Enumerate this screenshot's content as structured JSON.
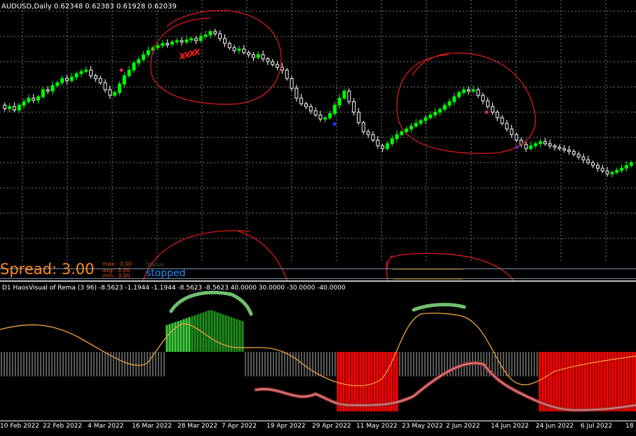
{
  "chart": {
    "symbol_title": "AUDUSD,Daily  0.62348 0.62383 0.61928 0.62039",
    "bull_color": "#00ff00",
    "bear_color": "#ffffff",
    "grid_color": "#7a7a7a",
    "annotation_color": "#e31d1d"
  },
  "spread": {
    "label": "Spread: 3.00",
    "stats": [
      {
        "label": "max:",
        "value": "3.00"
      },
      {
        "label": "avg:",
        "value": "3.00"
      },
      {
        "label": "min:",
        "value": "3.00"
      }
    ],
    "status_caption": "Status",
    "status_value": "stopped"
  },
  "indicator": {
    "title": "D1 HaosVisual of Rema (3 96) -8.5623 -1.1944 -1.1944 -8.5623 -8.5623 40.0000 30.0000 -30.0000 -40.0000",
    "up_color": "#1e8c1e",
    "down_color": "#ff0000",
    "fast_line_color": "#f2a33a"
  },
  "time_axis": {
    "labels": [
      "10 Feb 2022",
      "22 Feb 2022",
      "4 Mar 2022",
      "16 Mar 2022",
      "28 Mar 2022",
      "7 Apr 2022",
      "19 Apr 2022",
      "29 Apr 2022",
      "11 May 2022",
      "23 May 2022",
      "2 Jun 2022",
      "14 Jun 2022",
      "24 Jun 2022",
      "6 Jul 2022",
      "18"
    ]
  }
}
